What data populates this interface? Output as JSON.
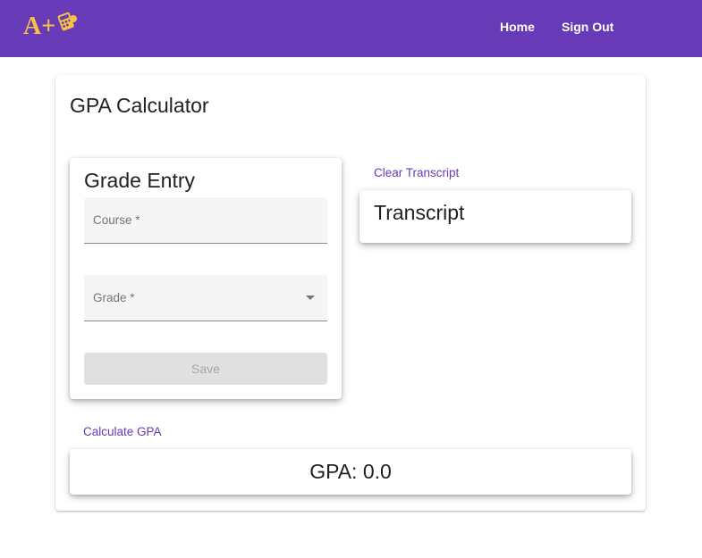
{
  "header": {
    "logo_text": "A+",
    "nav": {
      "home": "Home",
      "sign_out": "Sign Out"
    }
  },
  "page": {
    "title": "GPA Calculator"
  },
  "grade_entry": {
    "title": "Grade Entry",
    "course_label": "Course *",
    "grade_label": "Grade *",
    "save_label": "Save"
  },
  "transcript": {
    "clear_label": "Clear Transcript",
    "title": "Transcript"
  },
  "gpa": {
    "calculate_label": "Calculate GPA",
    "result_text": "GPA: 0.0"
  },
  "colors": {
    "primary": "#673ab7",
    "logo_accent": "#f5c242"
  },
  "icons": [
    "a-plus-calculator-logo-icon",
    "dropdown-caret-icon"
  ]
}
